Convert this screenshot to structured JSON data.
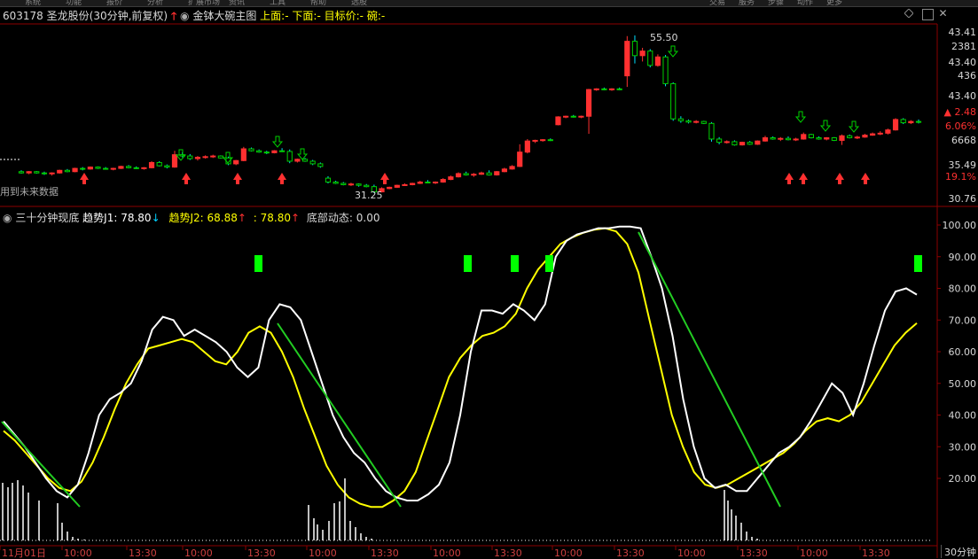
{
  "top_menu": [
    "系统",
    "功能",
    "报价",
    "分析",
    "扩展市场",
    "资讯",
    "工具",
    "帮助",
    "选股"
  ],
  "top_right_menu": [
    "交易",
    "服务",
    "步骤",
    "动作",
    "更多"
  ],
  "header": {
    "code": "603178",
    "name": "圣龙股份",
    "period": "(30分钟,前复权)",
    "indicator": "金钵大碗主图",
    "upper_label": "上面:",
    "upper_value": "-",
    "lower_label": "下面:",
    "lower_value": "-",
    "target_label": "目标价:",
    "target_value": "-",
    "bowl_label": "碗:",
    "bowl_value": "-"
  },
  "future_data_note": "用到未来数据",
  "price_annotations": {
    "high": "55.50",
    "low": "31.25"
  },
  "price_axis": [
    "43.41",
    "2381",
    "43.40",
    "436",
    "43.40",
    "2.48",
    "6.06%",
    "6668",
    "35.49",
    "19.1%",
    "30.76"
  ],
  "sub_header": {
    "name": "三十分钟现底",
    "j1_label": "趋势J1:",
    "j1_value": "78.80",
    "j2_label": "趋势J2:",
    "j2_value": "68.88",
    "j3_label": ":",
    "j3_value": "78.80",
    "bottom_label": "底部动态:",
    "bottom_value": "0.00"
  },
  "sub_axis": [
    "100.00",
    "90.00",
    "80.00",
    "70.00",
    "60.00",
    "50.00",
    "40.00",
    "30.00",
    "20.00"
  ],
  "time_axis": [
    "11月01日",
    "10:00",
    "13:30",
    "10:00",
    "13:30",
    "10:00",
    "13:30",
    "10:00",
    "13:30",
    "10:00",
    "13:30",
    "10:00",
    "13:30",
    "10:00",
    "13:30"
  ],
  "period_button": "30分钟",
  "colors": {
    "up": "#ff3030",
    "down": "#00d000",
    "grid": "#8b0000",
    "white_line": "#ffffff",
    "yellow_line": "#ffff00",
    "trend_line": "#22cc22",
    "signal": "#00ff00"
  },
  "chart_data": {
    "type": "candlestick",
    "ylim": [
      30.76,
      55.5
    ],
    "candles": [
      [
        34.6,
        34.8,
        34.3,
        34.4
      ],
      [
        34.4,
        34.7,
        34.2,
        34.6
      ],
      [
        34.6,
        34.7,
        34.3,
        34.4
      ],
      [
        34.4,
        34.6,
        34.1,
        34.3
      ],
      [
        34.3,
        34.5,
        34.0,
        34.4
      ],
      [
        34.4,
        34.9,
        34.3,
        34.8
      ],
      [
        34.8,
        35.0,
        34.5,
        34.6
      ],
      [
        34.6,
        35.2,
        34.5,
        35.1
      ],
      [
        35.1,
        35.3,
        34.8,
        35.0
      ],
      [
        35.0,
        35.4,
        34.9,
        35.3
      ],
      [
        35.3,
        35.4,
        35.0,
        35.1
      ],
      [
        35.1,
        35.3,
        34.9,
        35.0
      ],
      [
        35.0,
        35.2,
        34.8,
        35.1
      ],
      [
        35.1,
        35.5,
        35.0,
        35.4
      ],
      [
        35.4,
        35.6,
        35.1,
        35.2
      ],
      [
        35.2,
        35.4,
        35.0,
        35.1
      ],
      [
        35.1,
        35.3,
        34.9,
        35.2
      ],
      [
        35.2,
        36.2,
        35.1,
        36.0
      ],
      [
        36.0,
        36.2,
        35.4,
        35.5
      ],
      [
        35.5,
        35.7,
        35.1,
        35.3
      ],
      [
        35.3,
        37.8,
        35.2,
        37.2
      ],
      [
        37.2,
        37.6,
        36.8,
        37.0
      ],
      [
        37.0,
        37.3,
        36.4,
        36.6
      ],
      [
        36.6,
        37.0,
        36.3,
        36.8
      ],
      [
        36.8,
        37.1,
        36.6,
        36.9
      ],
      [
        36.9,
        37.2,
        36.7,
        37.0
      ],
      [
        37.0,
        37.1,
        36.6,
        36.7
      ],
      [
        36.7,
        36.9,
        35.6,
        35.8
      ],
      [
        35.8,
        36.4,
        35.6,
        36.3
      ],
      [
        36.3,
        38.4,
        36.2,
        38.1
      ],
      [
        38.1,
        38.3,
        37.7,
        37.8
      ],
      [
        37.8,
        38.0,
        37.5,
        37.6
      ],
      [
        37.6,
        37.8,
        37.3,
        37.5
      ],
      [
        37.5,
        37.9,
        37.4,
        37.8
      ],
      [
        37.8,
        38.2,
        37.6,
        37.7
      ],
      [
        37.7,
        38.0,
        35.9,
        36.2
      ],
      [
        36.2,
        36.6,
        36.0,
        36.5
      ],
      [
        36.5,
        36.7,
        36.1,
        36.2
      ],
      [
        36.2,
        36.4,
        35.6,
        35.8
      ],
      [
        35.8,
        36.0,
        35.2,
        35.4
      ],
      [
        33.6,
        33.9,
        32.8,
        33.0
      ],
      [
        33.0,
        33.2,
        32.7,
        32.8
      ],
      [
        32.8,
        33.0,
        32.5,
        32.6
      ],
      [
        32.6,
        32.9,
        32.4,
        32.7
      ],
      [
        32.7,
        32.8,
        32.3,
        32.5
      ],
      [
        32.5,
        32.7,
        32.2,
        32.3
      ],
      [
        32.3,
        32.6,
        31.3,
        31.5
      ],
      [
        31.5,
        32.2,
        31.4,
        32.0
      ],
      [
        32.0,
        32.3,
        31.9,
        32.2
      ],
      [
        32.2,
        32.6,
        32.1,
        32.5
      ],
      [
        32.5,
        32.8,
        32.4,
        32.6
      ],
      [
        32.6,
        32.9,
        32.5,
        32.8
      ],
      [
        32.8,
        33.2,
        32.7,
        33.0
      ],
      [
        33.0,
        33.3,
        32.8,
        32.9
      ],
      [
        32.9,
        33.1,
        32.7,
        33.0
      ],
      [
        33.0,
        33.6,
        32.9,
        33.4
      ],
      [
        33.4,
        34.0,
        33.3,
        33.8
      ],
      [
        33.8,
        34.5,
        33.7,
        34.3
      ],
      [
        34.3,
        34.6,
        34.0,
        34.1
      ],
      [
        34.1,
        34.4,
        33.8,
        34.2
      ],
      [
        34.2,
        34.6,
        34.1,
        34.4
      ],
      [
        34.4,
        34.8,
        34.0,
        34.1
      ],
      [
        34.1,
        34.7,
        34.0,
        34.6
      ],
      [
        34.6,
        35.2,
        34.5,
        35.0
      ],
      [
        35.0,
        35.6,
        34.9,
        35.4
      ],
      [
        35.4,
        38.8,
        35.3,
        37.6
      ],
      [
        37.6,
        39.6,
        37.4,
        39.3
      ],
      [
        39.3,
        39.5,
        39.0,
        39.4
      ],
      [
        39.4,
        39.6,
        39.2,
        39.5
      ],
      [
        39.5,
        39.7,
        39.3,
        39.4
      ],
      [
        41.8,
        43.1,
        41.7,
        43.0
      ],
      [
        43.0,
        43.2,
        42.8,
        43.1
      ],
      [
        43.1,
        43.3,
        42.9,
        43.0
      ],
      [
        43.0,
        43.2,
        42.8,
        43.1
      ],
      [
        43.1,
        47.3,
        40.4,
        47.2
      ],
      [
        47.2,
        47.4,
        47.0,
        47.3
      ],
      [
        47.3,
        47.5,
        47.1,
        47.2
      ],
      [
        47.2,
        47.4,
        47.0,
        47.3
      ],
      [
        47.3,
        47.5,
        47.1,
        47.2
      ],
      [
        49.3,
        55.4,
        47.6,
        54.6
      ],
      [
        54.6,
        55.5,
        51.2,
        52.4
      ],
      [
        52.4,
        53.6,
        51.5,
        53.1
      ],
      [
        53.1,
        53.4,
        50.6,
        50.9
      ],
      [
        50.9,
        52.6,
        50.7,
        52.2
      ],
      [
        52.2,
        52.5,
        47.7,
        48.1
      ],
      [
        48.1,
        48.3,
        42.4,
        42.7
      ],
      [
        42.7,
        43.1,
        42.1,
        42.4
      ],
      [
        42.4,
        42.6,
        42.0,
        42.2
      ],
      [
        42.2,
        42.5,
        42.0,
        42.3
      ],
      [
        42.3,
        42.4,
        41.9,
        42.0
      ],
      [
        42.0,
        42.2,
        39.2,
        39.6
      ],
      [
        39.6,
        39.9,
        38.8,
        39.1
      ],
      [
        39.1,
        39.4,
        38.9,
        39.2
      ],
      [
        39.2,
        39.4,
        38.6,
        38.7
      ],
      [
        38.7,
        39.2,
        38.6,
        39.1
      ],
      [
        39.1,
        39.3,
        38.7,
        38.8
      ],
      [
        38.8,
        39.4,
        38.7,
        39.3
      ],
      [
        39.3,
        40.1,
        39.2,
        39.8
      ],
      [
        39.8,
        40.0,
        39.5,
        39.6
      ],
      [
        39.6,
        39.9,
        39.3,
        39.7
      ],
      [
        39.7,
        40.0,
        39.4,
        39.5
      ],
      [
        39.5,
        39.8,
        39.3,
        39.6
      ],
      [
        39.6,
        40.6,
        39.5,
        40.3
      ],
      [
        40.3,
        40.4,
        39.7,
        39.8
      ],
      [
        39.8,
        40.0,
        39.5,
        39.6
      ],
      [
        39.6,
        39.9,
        39.4,
        39.8
      ],
      [
        39.8,
        39.9,
        39.3,
        39.4
      ],
      [
        39.4,
        40.3,
        38.7,
        40.1
      ],
      [
        40.1,
        40.3,
        39.7,
        39.8
      ],
      [
        39.8,
        40.1,
        39.6,
        39.9
      ],
      [
        39.9,
        40.4,
        39.8,
        40.2
      ],
      [
        40.2,
        40.6,
        40.1,
        40.4
      ],
      [
        40.4,
        40.8,
        40.2,
        40.5
      ],
      [
        40.5,
        41.2,
        40.3,
        41.0
      ],
      [
        41.0,
        42.8,
        40.9,
        42.6
      ],
      [
        42.6,
        42.8,
        41.9,
        42.1
      ],
      [
        42.1,
        42.5,
        41.9,
        42.3
      ],
      [
        42.3,
        42.6,
        42.0,
        42.2
      ]
    ],
    "sub_indicator": {
      "ylim": [
        0,
        100
      ],
      "j1_white": [
        38,
        34,
        30,
        25,
        20,
        16,
        14,
        18,
        28,
        40,
        45,
        47,
        50,
        57,
        67,
        71,
        70,
        65,
        67,
        65,
        63,
        60,
        55,
        52,
        55,
        70,
        75,
        74,
        70,
        60,
        50,
        40,
        33,
        28,
        25,
        20,
        16,
        14,
        13,
        13,
        15,
        18,
        25,
        40,
        60,
        73,
        73,
        72,
        75,
        73,
        70,
        75,
        90,
        95,
        97,
        98,
        99,
        99,
        99.5,
        99.5,
        99,
        90,
        80,
        65,
        45,
        30,
        20,
        17,
        18,
        16,
        16,
        20,
        24,
        28,
        30,
        33,
        38,
        44,
        50,
        47,
        40,
        50,
        62,
        73,
        79,
        80,
        78
      ],
      "j2_yellow": [
        35,
        32,
        28,
        24,
        20,
        17,
        16,
        19,
        25,
        33,
        42,
        50,
        56,
        61,
        62,
        63,
        64,
        63,
        60,
        57,
        56,
        60,
        66,
        68,
        66,
        60,
        52,
        42,
        33,
        24,
        18,
        14,
        12,
        11,
        11,
        13,
        16,
        22,
        32,
        42,
        52,
        58,
        62,
        65,
        66,
        68,
        72,
        80,
        86,
        90,
        94,
        96,
        97.5,
        98.5,
        99,
        98,
        94,
        85,
        70,
        55,
        40,
        30,
        22,
        18,
        17,
        18,
        20,
        22,
        24,
        26,
        28,
        31,
        35,
        38,
        39,
        38,
        40,
        44,
        50,
        56,
        62,
        66,
        69
      ]
    }
  }
}
